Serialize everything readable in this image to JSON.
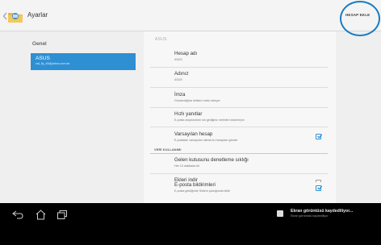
{
  "actionbar": {
    "title": "Ayarlar",
    "action_label": "HESAP EKLE",
    "highlight_color": "#1a7cc1"
  },
  "left_pane": {
    "general_label": "Genel",
    "account_title": "ASUS",
    "account_email": "cat_fly_45@yahoo.com.tw",
    "selected_color": "#2f8fd3"
  },
  "right_pane": {
    "header": "ASUS",
    "items": [
      {
        "title": "Hesap adı",
        "subtitle": "ASUS"
      },
      {
        "title": "Adınız",
        "subtitle": "ASUS"
      },
      {
        "title": "İmza",
        "subtitle": "Gönderdiğiniz iletilere metin ekleyin"
      },
      {
        "title": "Hızlı yanıtlar",
        "subtitle": "E-posta oluştururken sık girdiğiniz metinleri düzenleyin"
      },
      {
        "title": "Varsayılan hesap",
        "subtitle": "E-postaları varsayılan olarak bu hesaptan gönder",
        "checked": true
      },
      {
        "title": "Gelen kutusunu denetleme sıklığı",
        "subtitle": "Her 15 dakikada bir"
      },
      {
        "title": "Ekleri indir",
        "subtitle": "Son iletilerin eklerini Kablosuz üzerinden otomatik indir",
        "checked": false
      },
      {
        "title": "E-posta bildirimleri",
        "subtitle": "E-posta geldiğinde Sistem çubuğunda bildir",
        "checked": true
      }
    ],
    "sections": {
      "data_usage": "VERİ KULLANIMI",
      "notifications": "BİLDİRİM AYARLARI"
    }
  },
  "navbar": {
    "icons": [
      "back-icon",
      "home-icon",
      "recent-apps-icon"
    ],
    "notification_title": "Ekran görüntüsü kaydediliyor...",
    "notification_subtitle": "Ekran görüntüsü kaydediliyor."
  }
}
